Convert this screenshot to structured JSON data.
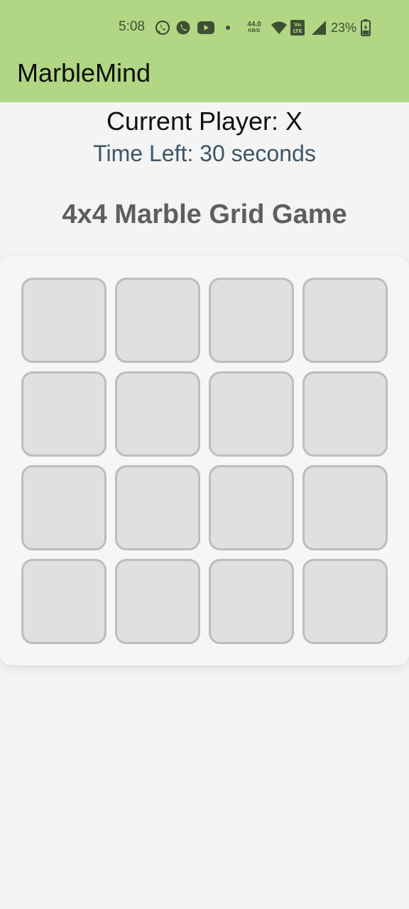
{
  "status_bar": {
    "time": "5:08",
    "net_speed_value": "44.0",
    "net_speed_unit": "KB/S",
    "battery_percent": "23%",
    "icons": [
      "whatsapp-icon",
      "viber-icon",
      "youtube-icon",
      "dot-icon",
      "wifi-icon",
      "volte-icon",
      "signal-icon",
      "battery-charging-icon"
    ]
  },
  "app_bar": {
    "title": "MarbleMind",
    "color": "#b1d684"
  },
  "game": {
    "current_player": "Current Player: X",
    "time_left": "Time Left: 30 seconds",
    "heading": "4x4 Marble Grid Game",
    "grid_rows": 4,
    "grid_cols": 4,
    "cells": [
      "",
      "",
      "",
      "",
      "",
      "",
      "",
      "",
      "",
      "",
      "",
      "",
      "",
      "",
      "",
      ""
    ]
  },
  "colors": {
    "background": "#f4f4f4",
    "cell_fill": "#e0e0e0",
    "cell_border": "#bdbdbd",
    "timer_text": "#3e5566",
    "heading_text": "#5e5e5e"
  }
}
